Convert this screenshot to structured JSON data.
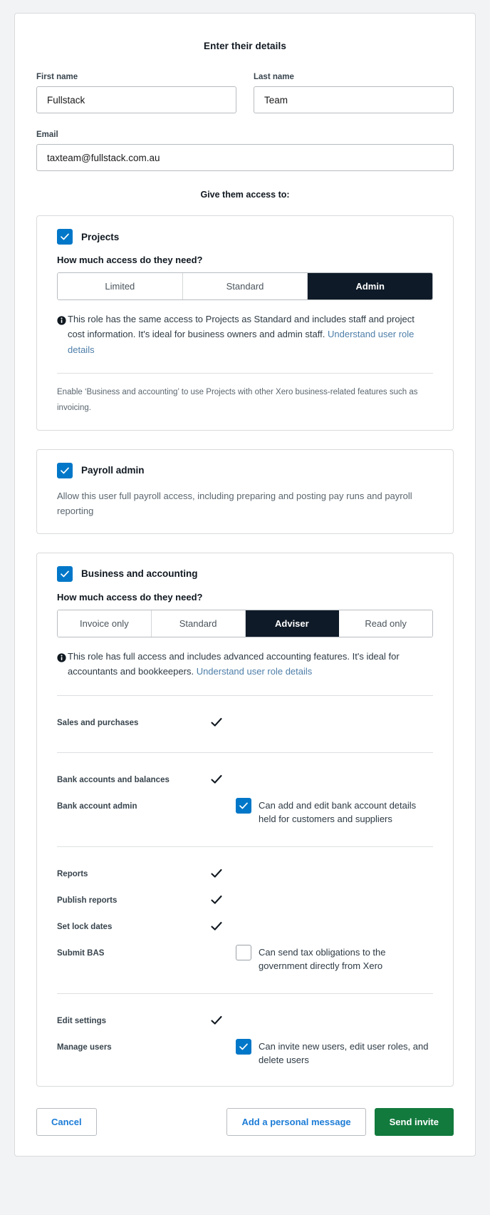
{
  "page": {
    "title": "Enter their details",
    "access_subhead": "Give them access to:"
  },
  "form": {
    "first_name": {
      "label": "First name",
      "value": "Fullstack",
      "placeholder": ""
    },
    "last_name": {
      "label": "Last name",
      "value": "Team",
      "placeholder": ""
    },
    "email": {
      "label": "Email",
      "value": "taxteam@fullstack.com.au",
      "placeholder": ""
    }
  },
  "colors": {
    "checkbox_blue": "#0077c8",
    "tab_active": "#0e1a27",
    "link_blue": "#4d7ea8",
    "send_green": "#127a3d",
    "button_text_blue": "#1c7cd6"
  },
  "projects": {
    "checkbox_label": "Projects",
    "checked": true,
    "question": "How much access do they need?",
    "tabs": [
      {
        "label": "Limited",
        "active": false
      },
      {
        "label": "Standard",
        "active": false
      },
      {
        "label": "Admin",
        "active": true
      }
    ],
    "info_text": "This role has the same access to Projects as Standard and includes staff and project cost information. It's ideal for business owners and admin staff. ",
    "info_link": "Understand user role details",
    "note": "Enable ‘Business and accounting’ to use Projects with other Xero business-related features such as invoicing."
  },
  "payroll": {
    "checkbox_label": "Payroll admin",
    "checked": true,
    "description": "Allow this user full payroll access, including preparing and posting pay runs and payroll reporting"
  },
  "business": {
    "checkbox_label": "Business and accounting",
    "checked": true,
    "question": "How much access do they need?",
    "tabs": [
      {
        "label": "Invoice only",
        "active": false
      },
      {
        "label": "Standard",
        "active": false
      },
      {
        "label": "Adviser",
        "active": true
      },
      {
        "label": "Read only",
        "active": false
      }
    ],
    "info_text": "This role has full access and includes advanced accounting features. It's ideal for accountants and bookkeepers. ",
    "info_link": "Understand user role details",
    "groups": [
      {
        "rows": [
          {
            "name": "Sales and purchases",
            "type": "tick",
            "extra": ""
          }
        ]
      },
      {
        "rows": [
          {
            "name": "Bank accounts and balances",
            "type": "tick",
            "extra": ""
          },
          {
            "name": "Bank account admin",
            "type": "checkbox",
            "checked": true,
            "extra": "Can add and edit bank account details held for customers and suppliers"
          }
        ]
      },
      {
        "rows": [
          {
            "name": "Reports",
            "type": "tick",
            "extra": ""
          },
          {
            "name": "Publish reports",
            "type": "tick",
            "extra": ""
          },
          {
            "name": "Set lock dates",
            "type": "tick",
            "extra": ""
          },
          {
            "name": "Submit BAS",
            "type": "checkbox",
            "checked": false,
            "extra": "Can send tax obligations to the government directly from Xero"
          }
        ]
      },
      {
        "rows": [
          {
            "name": "Edit settings",
            "type": "tick",
            "extra": ""
          },
          {
            "name": "Manage users",
            "type": "checkbox",
            "checked": true,
            "extra": "Can invite new users, edit user roles, and delete users"
          }
        ]
      }
    ]
  },
  "footer": {
    "cancel": "Cancel",
    "personal_message": "Add a personal message",
    "send_invite": "Send invite"
  }
}
